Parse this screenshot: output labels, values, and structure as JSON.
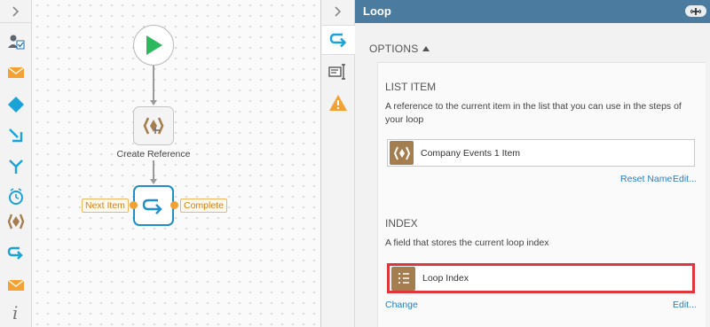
{
  "toolbox": {
    "expand_icon": "chevron-right-icon",
    "tools": [
      {
        "name": "user-task-icon",
        "color": "#5b6670"
      },
      {
        "name": "email-icon",
        "color": "#f2a234"
      },
      {
        "name": "decision-icon",
        "color": "#1aa3d9"
      },
      {
        "name": "merge-down-icon",
        "color": "#1aa3d9"
      },
      {
        "name": "branch-icon",
        "color": "#1aa3d9"
      },
      {
        "name": "timer-icon",
        "color": "#1aa3d9"
      },
      {
        "name": "create-reference-icon",
        "color": "#a57e50"
      },
      {
        "name": "loop-icon",
        "color": "#1aa3d9"
      },
      {
        "name": "email-icon",
        "color": "#f2a234"
      },
      {
        "name": "info-icon",
        "color": "#777777"
      }
    ]
  },
  "canvas": {
    "nodes": {
      "start": {
        "icon": "play-icon",
        "color": "#2eb85c"
      },
      "create_reference": {
        "label": "Create Reference"
      },
      "loop": {
        "icon": "loop-icon"
      }
    },
    "ports": {
      "next_item": "Next Item",
      "complete": "Complete"
    }
  },
  "side_strip": {
    "collapse_icon": "chevron-right-icon",
    "buttons": [
      "loop-icon",
      "text-cursor-icon",
      "warning-icon"
    ]
  },
  "panel": {
    "title": "Loop",
    "pin_icon": "pin-icon",
    "options_title": "OPTIONS",
    "list_item": {
      "heading": "LIST ITEM",
      "description": "A reference to the current item in the list that you can use in the steps of your loop",
      "field_value": "Company Events 1 Item",
      "reset_link": "Reset Name",
      "edit_link": "Edit..."
    },
    "index": {
      "heading": "INDEX",
      "description": "A field that stores the current loop index",
      "field_value": "Loop Index",
      "change_link": "Change",
      "edit_link": "Edit..."
    }
  },
  "colors": {
    "header": "#4c7ba0",
    "accent": "#1f8fc7",
    "port": "#f2a234",
    "highlight": "#e0353a",
    "reference": "#a57e50"
  }
}
